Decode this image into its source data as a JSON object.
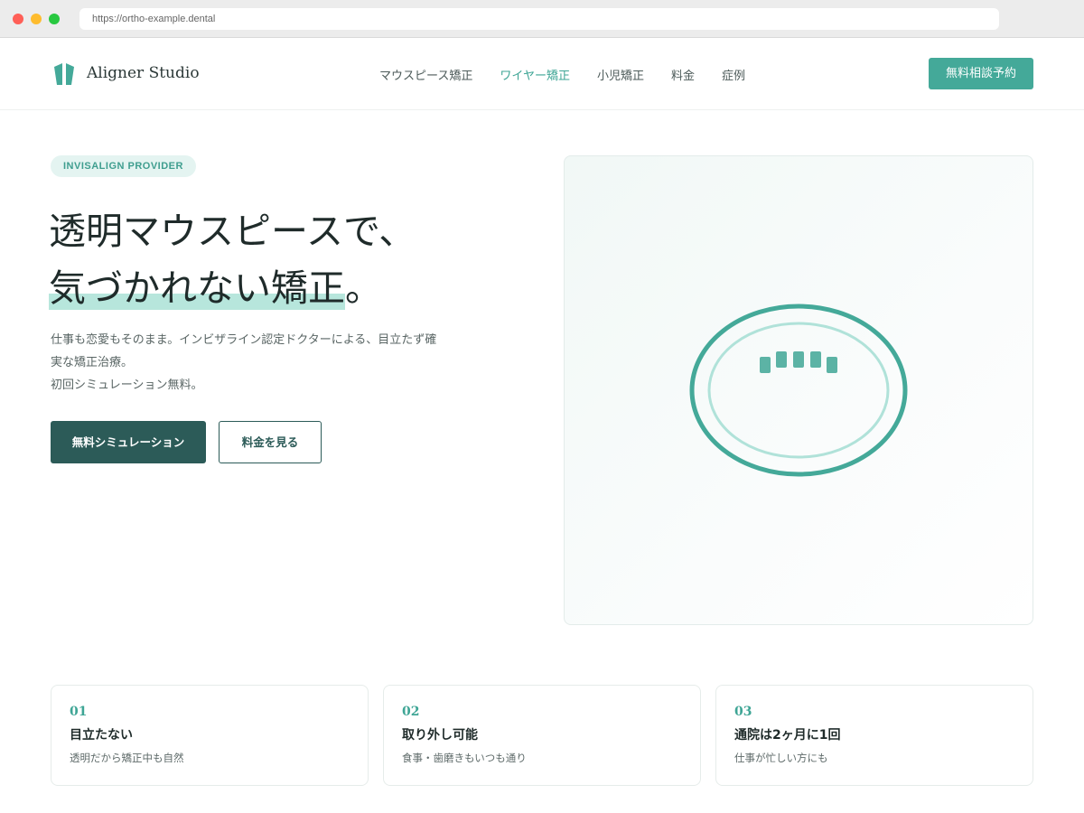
{
  "browser": {
    "url": "https://ortho-example.dental"
  },
  "header": {
    "brand": "Aligner Studio",
    "nav": [
      {
        "label": "マウスピース矯正",
        "active": false
      },
      {
        "label": "ワイヤー矯正",
        "active": true
      },
      {
        "label": "小児矯正",
        "active": false
      },
      {
        "label": "料金",
        "active": false
      },
      {
        "label": "症例",
        "active": false
      }
    ],
    "cta": "無料相談予約"
  },
  "hero": {
    "badge": "INVISALIGN PROVIDER",
    "title_line1": "透明マウスピースで、",
    "title_line2_highlight": "気づかれない矯正",
    "title_line2_tail": "。",
    "lead": [
      "仕事も恋愛もそのまま。インビザライン認定ドクターによる、目立たず確",
      "実な矯正治療。",
      "初回シミュレーション無料。"
    ],
    "primary_button": "無料シミュレーション",
    "secondary_button": "料金を見る"
  },
  "features": [
    {
      "num": "01",
      "title": "目立たない",
      "desc": "透明だから矯正中も自然"
    },
    {
      "num": "02",
      "title": "取り外し可能",
      "desc": "食事・歯磨きもいつも通り"
    },
    {
      "num": "03",
      "title": "通院は2ヶ月に1回",
      "desc": "仕事が忙しい方にも"
    }
  ],
  "colors": {
    "accent": "#44a999",
    "dark": "#2c5b58",
    "highlight": "#b7e6dc"
  },
  "icons": {
    "logo": "tooth-logo-icon"
  }
}
